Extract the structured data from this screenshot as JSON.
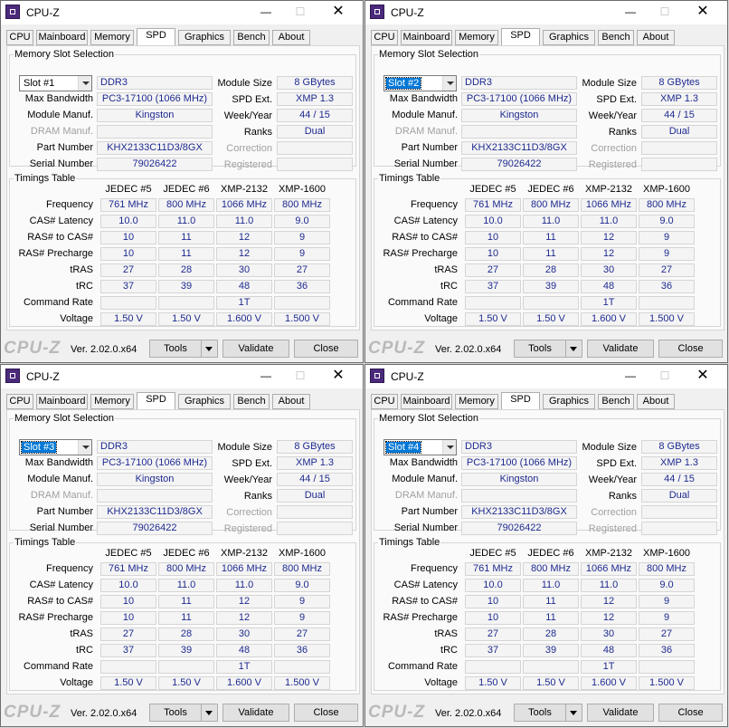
{
  "app": {
    "title": "CPU-Z",
    "version": "Ver. 2.02.0.x64",
    "brand": "CPU-Z",
    "tabs": [
      "CPU",
      "Mainboard",
      "Memory",
      "SPD",
      "Graphics",
      "Bench",
      "About"
    ],
    "active_tab": "SPD",
    "buttons": {
      "tools": "Tools",
      "validate": "Validate",
      "close": "Close"
    },
    "colors": {
      "value_text": "#1e2a90",
      "selection": "#0078d7",
      "icon": "#4b2a7c"
    }
  },
  "spd": {
    "group_slot": "Memory Slot Selection",
    "group_timings": "Timings Table",
    "labels": {
      "max_bandwidth": "Max Bandwidth",
      "module_manuf": "Module Manuf.",
      "dram_manuf": "DRAM Manuf.",
      "part_number": "Part Number",
      "serial_number": "Serial Number",
      "module_size": "Module Size",
      "spd_ext": "SPD Ext.",
      "week_year": "Week/Year",
      "ranks": "Ranks",
      "correction": "Correction",
      "registered": "Registered"
    },
    "timings": {
      "columns": [
        "JEDEC #5",
        "JEDEC #6",
        "XMP-2132",
        "XMP-1600"
      ],
      "rows": [
        {
          "label": "Frequency",
          "values": [
            "761 MHz",
            "800 MHz",
            "1066 MHz",
            "800 MHz"
          ]
        },
        {
          "label": "CAS# Latency",
          "values": [
            "10.0",
            "11.0",
            "11.0",
            "9.0"
          ]
        },
        {
          "label": "RAS# to CAS#",
          "values": [
            "10",
            "11",
            "12",
            "9"
          ]
        },
        {
          "label": "RAS# Precharge",
          "values": [
            "10",
            "11",
            "12",
            "9"
          ]
        },
        {
          "label": "tRAS",
          "values": [
            "27",
            "28",
            "30",
            "27"
          ]
        },
        {
          "label": "tRC",
          "values": [
            "37",
            "39",
            "48",
            "36"
          ]
        },
        {
          "label": "Command Rate",
          "values": [
            "",
            "",
            "1T",
            ""
          ]
        },
        {
          "label": "Voltage",
          "values": [
            "1.50 V",
            "1.50 V",
            "1.600 V",
            "1.500 V"
          ]
        }
      ]
    }
  },
  "windows": [
    {
      "slot": "Slot #1",
      "slot_focused": false,
      "type": "DDR3",
      "max_bandwidth": "PC3-17100 (1066 MHz)",
      "module_manuf": "Kingston",
      "dram_manuf": "",
      "part_number": "KHX2133C11D3/8GX",
      "serial_number": "79026422",
      "module_size": "8 GBytes",
      "spd_ext": "XMP 1.3",
      "week_year": "44 / 15",
      "ranks": "Dual",
      "correction": "",
      "registered": ""
    },
    {
      "slot": "Slot #2",
      "slot_focused": true,
      "type": "DDR3",
      "max_bandwidth": "PC3-17100 (1066 MHz)",
      "module_manuf": "Kingston",
      "dram_manuf": "",
      "part_number": "KHX2133C11D3/8GX",
      "serial_number": "79026422",
      "module_size": "8 GBytes",
      "spd_ext": "XMP 1.3",
      "week_year": "44 / 15",
      "ranks": "Dual",
      "correction": "",
      "registered": ""
    },
    {
      "slot": "Slot #3",
      "slot_focused": true,
      "type": "DDR3",
      "max_bandwidth": "PC3-17100 (1066 MHz)",
      "module_manuf": "Kingston",
      "dram_manuf": "",
      "part_number": "KHX2133C11D3/8GX",
      "serial_number": "79026422",
      "module_size": "8 GBytes",
      "spd_ext": "XMP 1.3",
      "week_year": "44 / 15",
      "ranks": "Dual",
      "correction": "",
      "registered": ""
    },
    {
      "slot": "Slot #4",
      "slot_focused": true,
      "type": "DDR3",
      "max_bandwidth": "PC3-17100 (1066 MHz)",
      "module_manuf": "Kingston",
      "dram_manuf": "",
      "part_number": "KHX2133C11D3/8GX",
      "serial_number": "79026422",
      "module_size": "8 GBytes",
      "spd_ext": "XMP 1.3",
      "week_year": "44 / 15",
      "ranks": "Dual",
      "correction": "",
      "registered": ""
    }
  ]
}
